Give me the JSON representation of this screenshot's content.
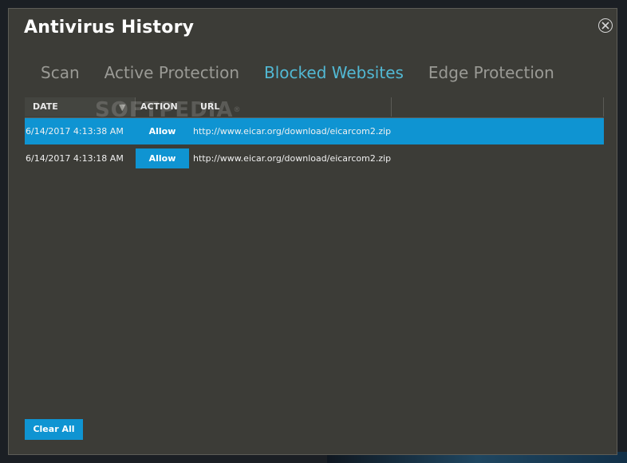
{
  "window": {
    "title": "Antivirus History"
  },
  "tabs": [
    {
      "label": "Scan",
      "active": false
    },
    {
      "label": "Active Protection",
      "active": false
    },
    {
      "label": "Blocked Websites",
      "active": true
    },
    {
      "label": "Edge Protection",
      "active": false
    }
  ],
  "table": {
    "columns": {
      "date": "DATE",
      "action": "ACTION",
      "url": "URL"
    },
    "sort_icon": "sort-down-icon",
    "rows": [
      {
        "date": "6/14/2017 4:13:38 AM",
        "action": "Allow",
        "url": "http://www.eicar.org/download/eicarcom2.zip",
        "selected": true
      },
      {
        "date": "6/14/2017 4:13:18 AM",
        "action": "Allow",
        "url": "http://www.eicar.org/download/eicarcom2.zip",
        "selected": false
      }
    ]
  },
  "watermark": {
    "text": "SOFTPEDIA",
    "mark": "®"
  },
  "footer": {
    "clear_all_label": "Clear All"
  },
  "colors": {
    "accent": "#0f94d2",
    "active_tab": "#52b9d4",
    "window_bg": "#3c3c37"
  }
}
